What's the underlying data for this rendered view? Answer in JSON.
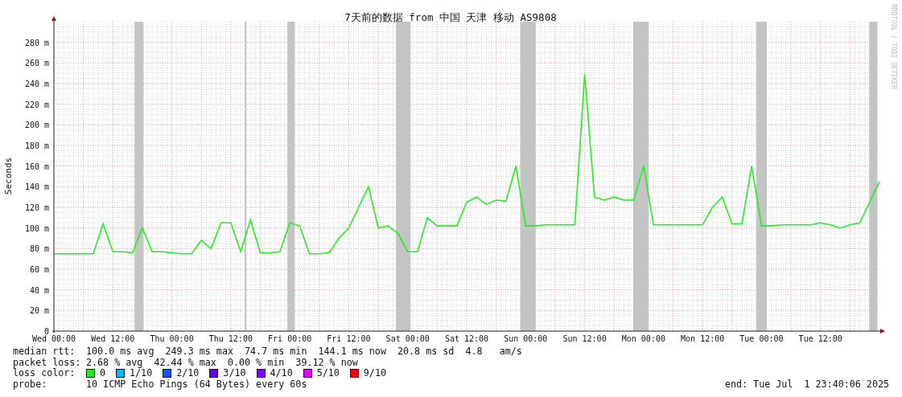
{
  "graph": {
    "chart_data": {
      "type": "line",
      "title": "7天前的数据 from 中国 天津 移动 AS9808",
      "ylabel": "Seconds",
      "categories": [
        "Wed 00:00",
        null,
        null,
        null,
        null,
        null,
        "Wed 12:00",
        null,
        null,
        null,
        null,
        null,
        "Thu 00:00",
        null,
        null,
        null,
        null,
        null,
        "Thu 12:00",
        null,
        null,
        null,
        null,
        null,
        "Fri 00:00",
        null,
        null,
        null,
        null,
        null,
        "Fri 12:00",
        null,
        null,
        null,
        null,
        null,
        "Sat 00:00",
        null,
        null,
        null,
        null,
        null,
        "Sat 12:00",
        null,
        null,
        null,
        null,
        null,
        "Sun 00:00",
        null,
        null,
        null,
        null,
        null,
        "Sun 12:00",
        null,
        null,
        null,
        null,
        null,
        "Mon 00:00",
        null,
        null,
        null,
        null,
        null,
        "Mon 12:00",
        null,
        null,
        null,
        null,
        null,
        "Tue 00:00",
        null,
        null,
        null,
        null,
        null,
        "Tue 12:00",
        null,
        null,
        null,
        null,
        null,
        null
      ],
      "series": [
        {
          "color": "#22ee22",
          "values": [
            75,
            75,
            75,
            75,
            75,
            104,
            77,
            77,
            76,
            100,
            77,
            77,
            76,
            75,
            75,
            88,
            80,
            105,
            105,
            77,
            108,
            76,
            76,
            77,
            105,
            102,
            75,
            75,
            76,
            90,
            100,
            120,
            140,
            100,
            102,
            95,
            77,
            77,
            110,
            102,
            102,
            102,
            125,
            130,
            123,
            127,
            126,
            160,
            102,
            102,
            103,
            103,
            103,
            103,
            249,
            130,
            127,
            130,
            127,
            127,
            160,
            103,
            103,
            103,
            103,
            103,
            103,
            120,
            130,
            104,
            104,
            160,
            102,
            102,
            103,
            103,
            103,
            103,
            105,
            103,
            100,
            103,
            105,
            125,
            145
          ]
        }
      ],
      "ylim": [
        0,
        300
      ],
      "yticks": [
        {
          "value": 0,
          "label": "0"
        },
        {
          "value": 20,
          "label": "20 m"
        },
        {
          "value": 40,
          "label": "40 m"
        },
        {
          "value": 60,
          "label": "60 m"
        },
        {
          "value": 80,
          "label": "80 m"
        },
        {
          "value": 100,
          "label": "100 m"
        },
        {
          "value": 120,
          "label": "120 m"
        },
        {
          "value": 140,
          "label": "140 m"
        },
        {
          "value": 160,
          "label": "160 m"
        },
        {
          "value": 180,
          "label": "180 m"
        },
        {
          "value": 200,
          "label": "200 m"
        },
        {
          "value": 220,
          "label": "220 m"
        },
        {
          "value": 240,
          "label": "240 m"
        },
        {
          "value": 260,
          "label": "260 m"
        },
        {
          "value": 280,
          "label": "280 m"
        }
      ],
      "grid": true
    },
    "credit": "RRDTOOL / TOBI OETIKER"
  },
  "legend": {
    "rows": [
      {
        "label": "median rtt:",
        "text": "100.0 ms avg  249.3 ms max  74.7 ms min  144.1 ms now  20.8 ms sd  4.8   am/s"
      },
      {
        "label": "packet loss:",
        "text": "2.68 % avg  42.44 % max  0.00 % min  39.12 % now"
      }
    ],
    "loss_label": "loss color:",
    "loss_colors": [
      {
        "label": "0",
        "color": "#22ee22"
      },
      {
        "label": "1/10",
        "color": "#00b8ff"
      },
      {
        "label": "2/10",
        "color": "#0059ff"
      },
      {
        "label": "3/10",
        "color": "#5e00ff"
      },
      {
        "label": "4/10",
        "color": "#7e00ff"
      },
      {
        "label": "5/10",
        "color": "#dd00ff"
      },
      {
        "label": "9/10",
        "color": "#ff0000"
      }
    ],
    "probe_label": "probe:",
    "probe": "10 ICMP Echo Pings (64 Bytes) every 60s",
    "end": "end: Tue Jul  1 23:40:06 2025"
  }
}
